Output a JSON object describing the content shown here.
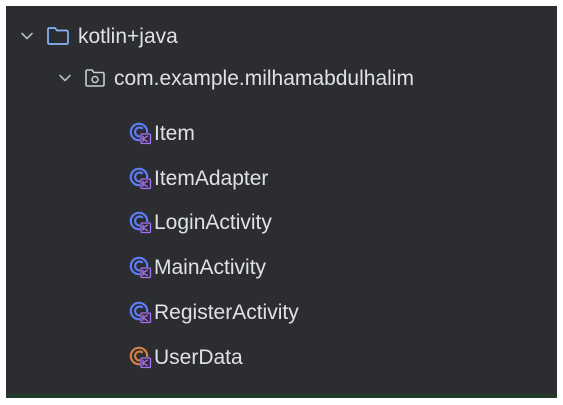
{
  "tree": {
    "root": {
      "label": "kotlin+java",
      "icon": "folder-icon",
      "expanded": true
    },
    "package": {
      "label": "com.example.milhamabdulhalim",
      "icon": "package-icon",
      "expanded": true
    },
    "classes": [
      {
        "label": "Item",
        "icon": "kotlin-class-icon",
        "color": "#5c7cf8"
      },
      {
        "label": "ItemAdapter",
        "icon": "kotlin-class-icon",
        "color": "#5c7cf8"
      },
      {
        "label": "LoginActivity",
        "icon": "kotlin-class-icon",
        "color": "#5c7cf8"
      },
      {
        "label": "MainActivity",
        "icon": "kotlin-class-icon",
        "color": "#5c7cf8"
      },
      {
        "label": "RegisterActivity",
        "icon": "kotlin-class-icon",
        "color": "#5c7cf8"
      },
      {
        "label": "UserData",
        "icon": "kotlin-data-class-icon",
        "color": "#d47f44"
      }
    ]
  },
  "colors": {
    "background": "#2b2d30",
    "text": "#dfe1e5",
    "folder": "#8ab4f8",
    "kotlin_badge": "#a971f7"
  }
}
